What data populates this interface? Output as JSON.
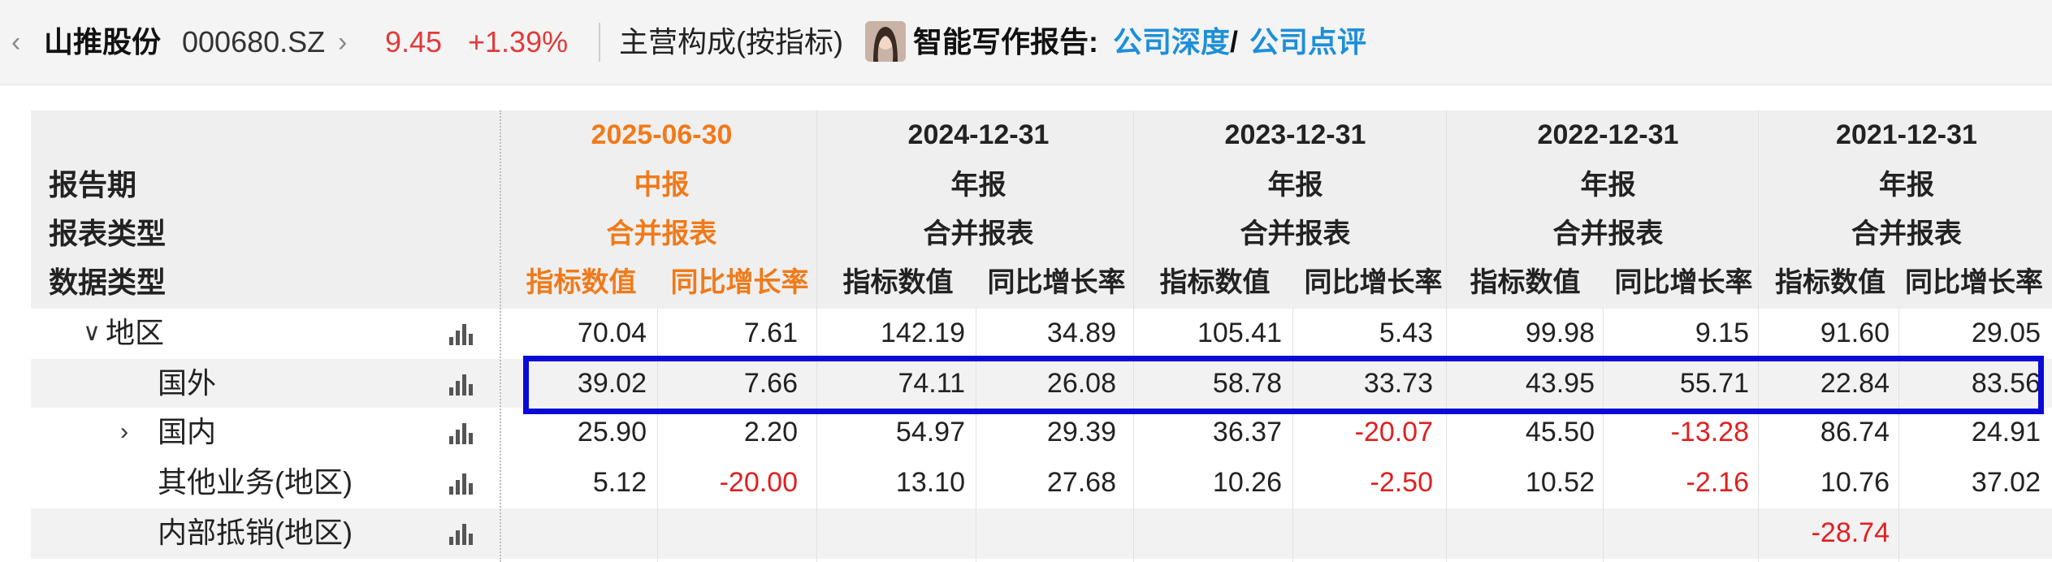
{
  "header": {
    "back_arrow": "‹",
    "stock_name": "山推股份",
    "stock_code": "000680.SZ",
    "forward_arrow": "›",
    "price": "9.45",
    "change_pct": "+1.39%",
    "section_title": "主营构成(按指标)",
    "report_label": "智能写作报告:",
    "link_deep": "公司深度",
    "link_sep": "/",
    "link_review": "公司点评"
  },
  "table": {
    "row_labels": {
      "period": "报告期",
      "report_type": "报表类型",
      "data_type": "数据类型"
    },
    "periods": [
      {
        "date": "2025-06-30",
        "report": "中报",
        "statement": "合并报表",
        "metric": "指标数值",
        "growth": "同比增长率"
      },
      {
        "date": "2024-12-31",
        "report": "年报",
        "statement": "合并报表",
        "metric": "指标数值",
        "growth": "同比增长率"
      },
      {
        "date": "2023-12-31",
        "report": "年报",
        "statement": "合并报表",
        "metric": "指标数值",
        "growth": "同比增长率"
      },
      {
        "date": "2022-12-31",
        "report": "年报",
        "statement": "合并报表",
        "metric": "指标数值",
        "growth": "同比增长率"
      },
      {
        "date": "2021-12-31",
        "report": "年报",
        "statement": "合并报表",
        "metric": "指标数值",
        "growth": "同比增长率"
      }
    ],
    "rows": [
      {
        "label": "地区",
        "expander": "∨",
        "values": [
          "70.04",
          "7.61",
          "142.19",
          "34.89",
          "105.41",
          "5.43",
          "99.98",
          "9.15",
          "91.60",
          "29.05"
        ]
      },
      {
        "label": "国外",
        "expander": "",
        "values": [
          "39.02",
          "7.66",
          "74.11",
          "26.08",
          "58.78",
          "33.73",
          "43.95",
          "55.71",
          "22.84",
          "83.56"
        ]
      },
      {
        "label": "国内",
        "expander": "›",
        "values": [
          "25.90",
          "2.20",
          "54.97",
          "29.39",
          "36.37",
          "-20.07",
          "45.50",
          "-13.28",
          "86.74",
          "24.91"
        ]
      },
      {
        "label": "其他业务(地区)",
        "expander": "",
        "values": [
          "5.12",
          "-20.00",
          "13.10",
          "27.68",
          "10.26",
          "-2.50",
          "10.52",
          "-2.16",
          "10.76",
          "37.02"
        ]
      },
      {
        "label": "内部抵销(地区)",
        "expander": "",
        "values": [
          "",
          "",
          "",
          "",
          "",
          "",
          "",
          "",
          "-28.74",
          ""
        ]
      }
    ]
  },
  "colors": {
    "current_period": "#f07a1a",
    "negative": "#e02020",
    "price": "#e03a3a",
    "link": "#1e8fd8",
    "highlight": "#0a0ad8"
  }
}
